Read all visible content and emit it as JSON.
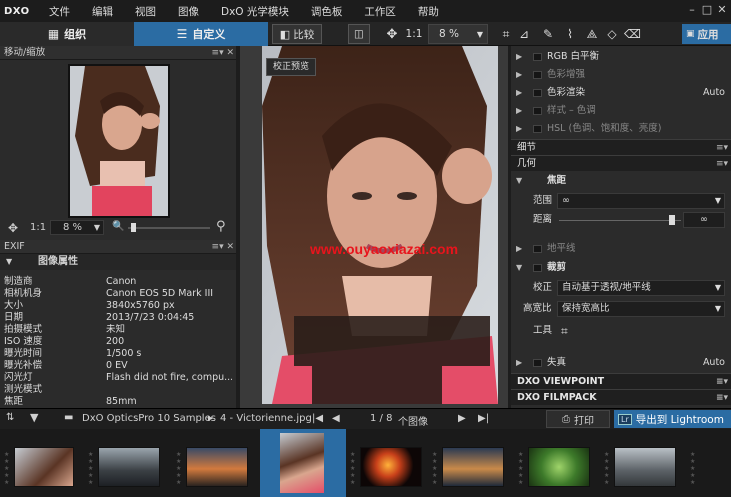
{
  "app": {
    "logo": "DXO"
  },
  "menu": [
    "文件",
    "编辑",
    "视图",
    "图像",
    "DxO 光学模块",
    "调色板",
    "工作区",
    "帮助"
  ],
  "window_controls": {
    "minimize": "–",
    "restore": "□",
    "close": "✕"
  },
  "toolbar": {
    "tab_organize": "组织",
    "tab_customize": "自定义",
    "compare_label": "比较",
    "zoom_1to1": "1:1",
    "zoom_value": "8 %",
    "apply_label": "应用"
  },
  "left_panel": {
    "move_zoom_title": "移动/缩放",
    "zoom_1to1": "1:1",
    "zoom_value": "8 %",
    "exif_title": "EXIF",
    "image_props_title": "图像属性",
    "exif_rows": [
      {
        "k": "制造商",
        "v": "Canon"
      },
      {
        "k": "相机机身",
        "v": "Canon EOS 5D Mark III"
      },
      {
        "k": "大小",
        "v": "3840x5760 px"
      },
      {
        "k": "日期",
        "v": "2013/7/23 0:04:45"
      },
      {
        "k": "拍摄模式",
        "v": "未知"
      },
      {
        "k": "ISO 速度",
        "v": "200"
      },
      {
        "k": "曝光时间",
        "v": "1/500 s"
      },
      {
        "k": "曝光补偿",
        "v": "0 EV"
      },
      {
        "k": "闪光灯",
        "v": "Flash did not fire, compu..."
      },
      {
        "k": "测光模式",
        "v": ""
      },
      {
        "k": "焦距",
        "v": "85mm"
      }
    ]
  },
  "center": {
    "preview_badge": "校正预览",
    "watermark": "www.ouyaoxiazai.com"
  },
  "right_panel": {
    "rows": [
      {
        "label": "RGB 白平衡",
        "dim": false
      },
      {
        "label": "色彩增强",
        "dim": true
      },
      {
        "label": "色彩渲染",
        "dim": false,
        "value": "Auto"
      },
      {
        "label": "样式 – 色调",
        "dim": true
      },
      {
        "label": "HSL (色调、饱和度、亮度)",
        "dim": true
      }
    ],
    "section_detail": "细节",
    "section_geometry": "几何",
    "focal_title": "焦距",
    "range_label": "范围",
    "range_value": "∞",
    "distance_label": "距离",
    "distance_value": "∞",
    "horizon_label": "地平线",
    "crop_title": "裁剪",
    "correction_label": "校正",
    "correction_value": "自动基于透视/地平线",
    "aspect_label": "高宽比",
    "aspect_value": "保持宽高比",
    "tool_label": "工具",
    "distortion_label": "失真",
    "distortion_value": "Auto",
    "viewpoint": "DXO VIEWPOINT",
    "filmpack": "DXO FILMPACK"
  },
  "bottom": {
    "path": "DxO OpticsPro 10 Samples",
    "file": "4 - Victorienne.jpg",
    "counter": "1 / 8",
    "counter_suffix": "个图像",
    "print_label": "打印",
    "export_label": "导出到 Lightroom",
    "export_badge": "Lr"
  },
  "colors": {
    "accent": "#2b6ca3",
    "export": "#2b6ca3",
    "watermark": "#e8141c"
  }
}
